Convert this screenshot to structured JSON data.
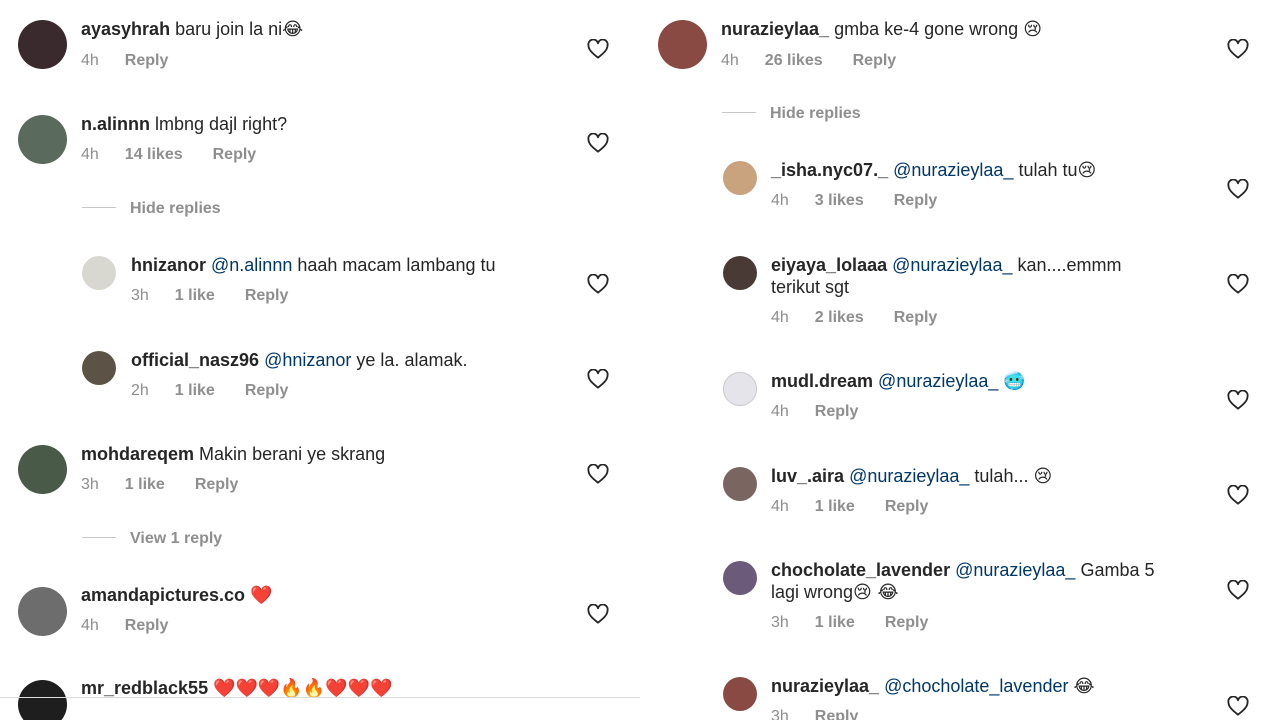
{
  "left": {
    "comments": [
      {
        "user": "ayasyhrah",
        "text": "baru join la ni",
        "emoji": "😂",
        "time": "4h",
        "likes": "",
        "reply": "Reply",
        "avatar_color": "#3a2a2e"
      },
      {
        "user": "n.alinnn",
        "text": "lmbng dajl right?",
        "emoji": "",
        "time": "4h",
        "likes": "14 likes",
        "reply": "Reply",
        "avatar_color": "#5a6a5c"
      },
      {
        "user": "hnizanor",
        "mention": "@n.alinnn",
        "text": "haah macam lambang tu",
        "time": "3h",
        "likes": "1 like",
        "reply": "Reply",
        "avatar_color": "#d8d8d0"
      },
      {
        "user": "official_nasz96",
        "mention": "@hnizanor",
        "text": "ye la. alamak.",
        "time": "2h",
        "likes": "1 like",
        "reply": "Reply",
        "avatar_color": "#5c5346"
      },
      {
        "user": "mohdareqem",
        "text": "Makin berani ye skrang",
        "time": "3h",
        "likes": "1 like",
        "reply": "Reply",
        "avatar_color": "#4a5a48"
      },
      {
        "user": "amandapictures.co",
        "emoji": "❤️",
        "time": "4h",
        "likes": "",
        "reply": "Reply",
        "avatar_color": "#6d6d6d"
      },
      {
        "user": "mr_redblack55",
        "emoji": "❤️❤️❤️🔥🔥❤️❤️❤️",
        "avatar_color": "#1e1e1e"
      }
    ],
    "hide_replies": "Hide replies",
    "view_reply": "View 1 reply"
  },
  "right": {
    "comments": [
      {
        "user": "nurazieylaa_",
        "text": "gmba ke-4 gone wrong",
        "emoji": "😢",
        "time": "4h",
        "likes": "26 likes",
        "reply": "Reply",
        "avatar_color": "#8a4a44"
      },
      {
        "user": "_isha.nyc07._",
        "mention": "@nurazieylaa_",
        "text": "tulah tu",
        "emoji": "😢",
        "time": "4h",
        "likes": "3 likes",
        "reply": "Reply",
        "avatar_color": "#c9a27e"
      },
      {
        "user": "eiyaya_lolaaa",
        "mention": "@nurazieylaa_",
        "text": "kan....emmm",
        "text2": "terikut sgt",
        "time": "4h",
        "likes": "2 likes",
        "reply": "Reply",
        "avatar_color": "#4a3a36"
      },
      {
        "user": "mudl.dream",
        "mention": "@nurazieylaa_",
        "emoji": "🥶",
        "time": "4h",
        "likes": "",
        "reply": "Reply",
        "avatar_color": "#e4e4ea"
      },
      {
        "user": "luv_.aira",
        "mention": "@nurazieylaa_",
        "text": "tulah...",
        "emoji": "😢",
        "time": "4h",
        "likes": "1 like",
        "reply": "Reply",
        "avatar_color": "#7a6660"
      },
      {
        "user": "chocholate_lavender",
        "mention": "@nurazieylaa_",
        "text": "Gamba 5",
        "text2": "lagi wrong",
        "emoji": "😢 😂",
        "time": "3h",
        "likes": "1 like",
        "reply": "Reply",
        "avatar_color": "#6b5a7a"
      },
      {
        "user": "nurazieylaa_",
        "mention": "@chocholate_lavender",
        "emoji": "😂",
        "time": "3h",
        "likes": "",
        "reply": "Reply",
        "avatar_color": "#8a4a44"
      }
    ],
    "hide_replies": "Hide replies"
  },
  "icons": {
    "like": "heart-outline-icon"
  },
  "colors": {
    "text": "#262626",
    "meta": "#8e8e8e",
    "mention": "#00376b"
  }
}
